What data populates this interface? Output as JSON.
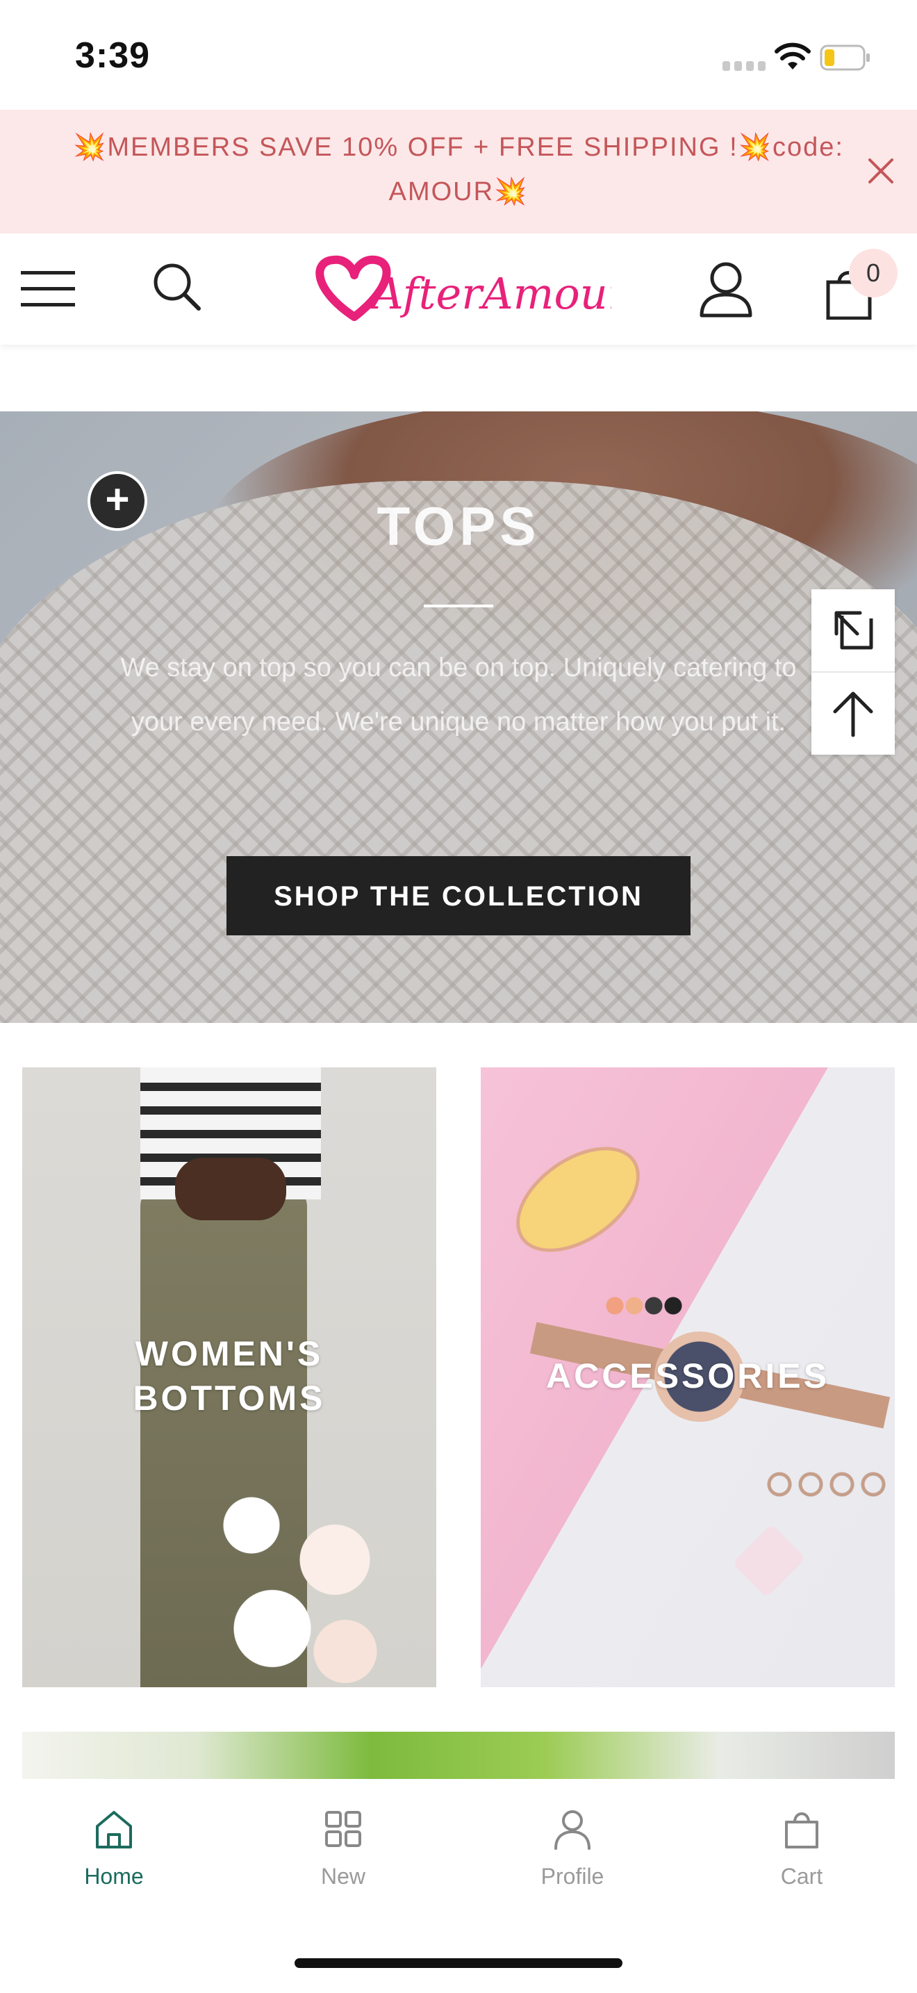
{
  "status_bar": {
    "time": "3:39"
  },
  "promo": {
    "text": "💥MEMBERS SAVE 10% OFF + FREE SHIPPING !💥code: AMOUR💥",
    "close_icon": "close-icon"
  },
  "header": {
    "logo_text": "AfterAmour",
    "cart_count": "0",
    "icons": [
      "menu-icon",
      "search-icon",
      "user-icon",
      "cart-icon"
    ]
  },
  "hero": {
    "title": "TOPS",
    "description": "We stay on top so you can be on top. Uniquely catering to your every need. We're unique no matter how you put it.",
    "cta_label": "SHOP THE COLLECTION",
    "side_tools": [
      "expand-icon",
      "arrow-up-icon"
    ]
  },
  "categories": [
    {
      "label": "WOMEN'S BOTTOMS"
    },
    {
      "label": "ACCESSORIES"
    }
  ],
  "tab_bar": {
    "tabs": [
      {
        "label": "Home",
        "icon": "home-icon",
        "active": true
      },
      {
        "label": "New",
        "icon": "grid-icon",
        "active": false
      },
      {
        "label": "Profile",
        "icon": "profile-icon",
        "active": false
      },
      {
        "label": "Cart",
        "icon": "bag-icon",
        "active": false
      }
    ]
  },
  "colors": {
    "promo_bg": "#fce8e8",
    "promo_text": "#c4565a",
    "brand_pink": "#e8217a",
    "active_tab": "#1c6b5e",
    "button_dark": "#222222"
  }
}
